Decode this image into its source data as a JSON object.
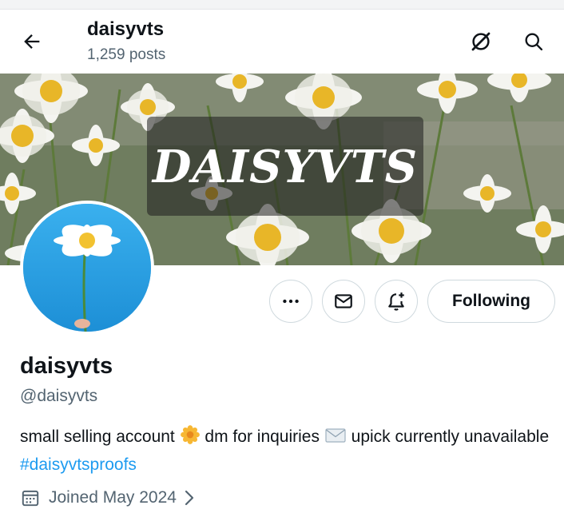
{
  "header": {
    "name": "daisyvts",
    "posts": "1,259 posts",
    "back_icon": "arrow-left-icon",
    "grok_icon": "grok-icon",
    "search_icon": "search-icon"
  },
  "banner": {
    "title": "DAISYVTS"
  },
  "actions": {
    "more_icon": "more-dots-icon",
    "message_icon": "mail-icon",
    "notify_icon": "bell-plus-icon",
    "following_label": "Following"
  },
  "profile": {
    "name": "daisyvts",
    "handle": "@daisyvts",
    "bio_part1": "small selling account ",
    "bio_part2": " dm for inquiries ",
    "bio_part3": " upick currently unavailable ",
    "hashtag": "#daisyvtsproofs",
    "joined": "Joined May 2024"
  },
  "colors": {
    "accent": "#1d9bf0",
    "text_primary": "#0f1419",
    "text_secondary": "#536471",
    "border": "#cfd9de"
  }
}
